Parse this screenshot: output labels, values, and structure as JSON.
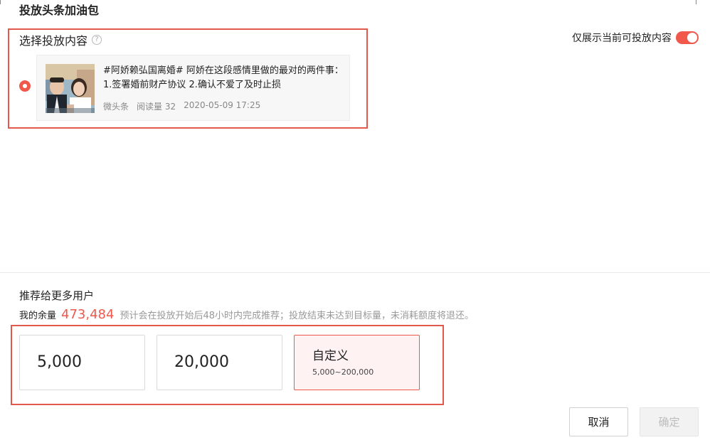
{
  "dialog": {
    "title": "投放头条加油包"
  },
  "content_section": {
    "label": "选择投放内容",
    "help_icon": "?",
    "filter_toggle": {
      "label": "仅展示当前可投放内容",
      "on": true,
      "accent": "#f0584c"
    }
  },
  "article": {
    "selected": true,
    "title": "#阿娇赖弘国离婚# 阿娇在这段感情里做的最对的两件事： 1.签署婚前财产协议 2.确认不爱了及时止损",
    "source": "微头条",
    "reads": "阅读量 32",
    "date": "2020-05-09 17:25"
  },
  "recommend_section": {
    "title": "推荐给更多用户",
    "balance_label": "我的余量",
    "balance_value": "473,484",
    "note": "预计会在投放开始后48小时内完成推荐；投放结束未达到目标量，未消耗额度将退还。",
    "options": [
      {
        "amount": "5,000"
      },
      {
        "amount": "20,000"
      }
    ],
    "custom": {
      "label": "自定义",
      "range": "5,000~200,000",
      "selected": true
    }
  },
  "footer": {
    "cancel_label": "取消",
    "confirm_label": "确定",
    "confirm_disabled": true
  },
  "colors": {
    "accent": "#f0584c",
    "highlight": "#e2584c",
    "custom_bg": "#fef3f2"
  }
}
